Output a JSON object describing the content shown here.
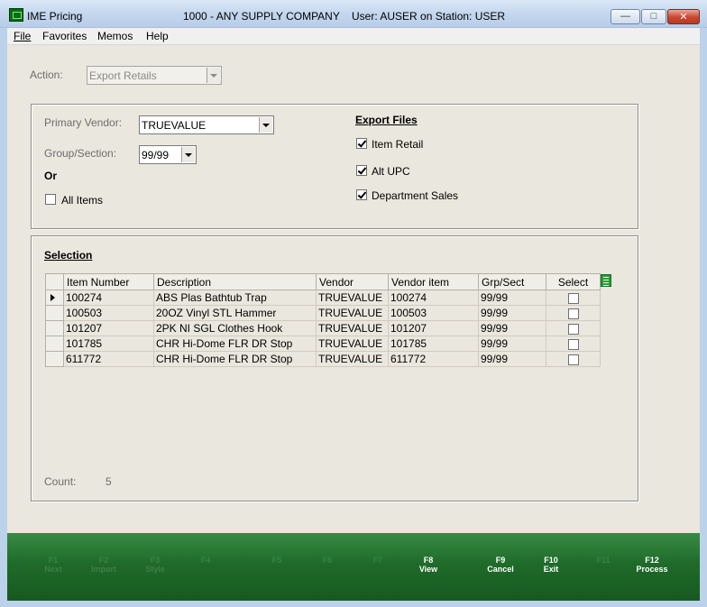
{
  "window": {
    "app_title": "IME Pricing",
    "company": "1000 - ANY SUPPLY COMPANY",
    "user_station": "User: AUSER on Station: USER"
  },
  "menu": [
    {
      "label": "File"
    },
    {
      "label": "Favorites"
    },
    {
      "label": "Memos"
    },
    {
      "label": "Help"
    }
  ],
  "action": {
    "label": "Action:",
    "value": "Export Retails"
  },
  "filters": {
    "primary_vendor_label": "Primary Vendor:",
    "primary_vendor_value": "TRUEVALUE",
    "group_section_label": "Group/Section:",
    "group_section_value": "99/99",
    "or_label": "Or",
    "all_items_label": "All Items",
    "all_items_checked": false
  },
  "export_files": {
    "title": "Export Files",
    "items": [
      {
        "label": "Item Retail",
        "checked": true
      },
      {
        "label": "Alt UPC",
        "checked": true
      },
      {
        "label": "Department Sales",
        "checked": true
      }
    ]
  },
  "selection": {
    "title": "Selection",
    "columns": [
      "Item Number",
      "Description",
      "Vendor",
      "Vendor item",
      "Grp/Sect",
      "Select"
    ],
    "rows": [
      {
        "item_number": "100274",
        "description": "ABS Plas Bathtub Trap",
        "vendor": "TRUEVALUE",
        "vendor_item": "100274",
        "grp_sect": "99/99",
        "selected": false,
        "current": true
      },
      {
        "item_number": "100503",
        "description": "20OZ Vinyl STL Hammer",
        "vendor": "TRUEVALUE",
        "vendor_item": "100503",
        "grp_sect": "99/99",
        "selected": false,
        "current": false
      },
      {
        "item_number": "101207",
        "description": "2PK NI SGL Clothes Hook",
        "vendor": "TRUEVALUE",
        "vendor_item": "101207",
        "grp_sect": "99/99",
        "selected": false,
        "current": false
      },
      {
        "item_number": "101785",
        "description": "CHR Hi-Dome FLR DR Stop",
        "vendor": "TRUEVALUE",
        "vendor_item": "101785",
        "grp_sect": "99/99",
        "selected": false,
        "current": false
      },
      {
        "item_number": "611772",
        "description": "CHR Hi-Dome FLR DR Stop",
        "vendor": "TRUEVALUE",
        "vendor_item": "611772",
        "grp_sect": "99/99",
        "selected": false,
        "current": false
      }
    ],
    "count_label": "Count:",
    "count_value": "5"
  },
  "function_keys": [
    {
      "key": "F1",
      "label": "Next",
      "enabled": false
    },
    {
      "key": "F2",
      "label": "Import",
      "enabled": false
    },
    {
      "key": "F3",
      "label": "Style",
      "enabled": false
    },
    {
      "key": "F4",
      "label": "",
      "enabled": false
    },
    {
      "key": "F5",
      "label": "",
      "enabled": false
    },
    {
      "key": "F6",
      "label": "",
      "enabled": false
    },
    {
      "key": "F7",
      "label": "",
      "enabled": false
    },
    {
      "key": "F8",
      "label": "View",
      "enabled": true
    },
    {
      "key": "F9",
      "label": "Cancel",
      "enabled": true
    },
    {
      "key": "F10",
      "label": "Exit",
      "enabled": true
    },
    {
      "key": "F11",
      "label": "",
      "enabled": false
    },
    {
      "key": "F12",
      "label": "Process",
      "enabled": true
    }
  ],
  "colors": {
    "client_bg": "#eae7de",
    "function_bar": "#1f6b2a",
    "close_button": "#c9452e"
  }
}
